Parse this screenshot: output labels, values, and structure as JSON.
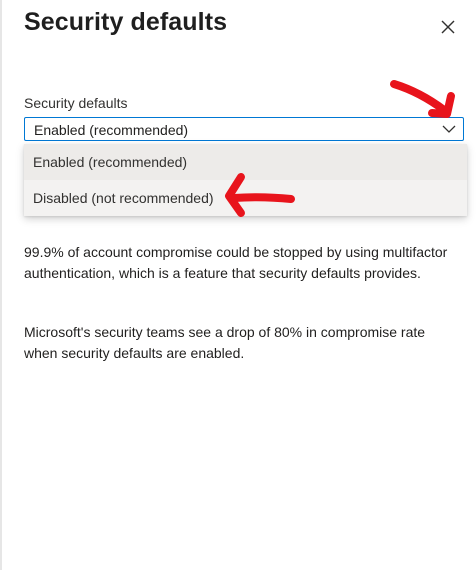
{
  "panel": {
    "title": "Security defaults",
    "close_icon": "close-icon"
  },
  "field": {
    "label": "Security defaults",
    "selected_value": "Enabled (recommended)",
    "accent_color": "#0078d4",
    "options": [
      "Enabled (recommended)",
      "Disabled (not recommended)"
    ]
  },
  "description": {
    "paragraph_1": "99.9% of account compromise could be stopped by using multifactor authentication, which is a feature that security defaults provides.",
    "paragraph_2": "Microsoft's security teams see a drop of 80% in compromise rate when security defaults are enabled."
  },
  "annotations": {
    "color": "#e8141c",
    "icons": [
      "red-arrow-to-chevron-icon",
      "red-arrow-to-disabled-option-icon"
    ]
  }
}
